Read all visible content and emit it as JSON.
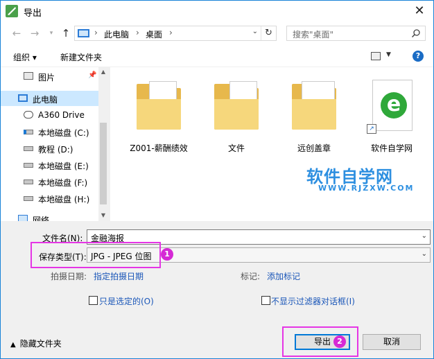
{
  "window": {
    "title": "导出"
  },
  "address": {
    "crumbs": [
      "此电脑",
      "桌面"
    ],
    "separator": "›"
  },
  "search": {
    "placeholder": "搜索\"桌面\""
  },
  "toolbar": {
    "organize_label": "组织 ▾",
    "new_folder_label": "新建文件夹",
    "help_label": "?"
  },
  "nav_pane": {
    "items": [
      {
        "label": "图片",
        "icon": "pictures-icon",
        "pinned": true
      },
      {
        "label": "此电脑",
        "icon": "computer-icon",
        "selected": true
      },
      {
        "label": "A360 Drive",
        "icon": "cloud-drive-icon"
      },
      {
        "label": "本地磁盘 (C:)",
        "icon": "windows-drive-icon"
      },
      {
        "label": "教程 (D:)",
        "icon": "drive-icon"
      },
      {
        "label": "本地磁盘 (E:)",
        "icon": "drive-icon"
      },
      {
        "label": "本地磁盘 (F:)",
        "icon": "drive-icon"
      },
      {
        "label": "本地磁盘 (H:)",
        "icon": "drive-icon"
      },
      {
        "label": "网络",
        "icon": "network-icon"
      }
    ]
  },
  "files": [
    {
      "name": "Z001-薪酬绩效",
      "type": "folder"
    },
    {
      "name": "文件",
      "type": "folder"
    },
    {
      "name": "远创盖章",
      "type": "folder"
    },
    {
      "name": "软件自学网",
      "type": "shortcut"
    }
  ],
  "watermark": {
    "title": "软件自学网",
    "url": "WWW.RJZXW.COM"
  },
  "form": {
    "filename_label": "文件名(N):",
    "filename_value": "金融海报",
    "filetype_label": "保存类型(T):",
    "filetype_value": "JPG - JPEG 位图",
    "date_label": "拍摄日期:",
    "date_link": "指定拍摄日期",
    "tags_label": "标记:",
    "tags_link": "添加标记",
    "selected_only_label": "只是选定的(O)",
    "no_filter_dialog_label": "不显示过滤器对话框(I)"
  },
  "footer": {
    "hide_folders_label": "隐藏文件夹",
    "export_label": "导出",
    "cancel_label": "取消"
  },
  "annotations": {
    "badge1": "1",
    "badge2": "2",
    "highlight_color": "#e535e5"
  },
  "colors": {
    "accent": "#0078d7",
    "selection": "#cce8ff",
    "link": "#1a56b8"
  }
}
